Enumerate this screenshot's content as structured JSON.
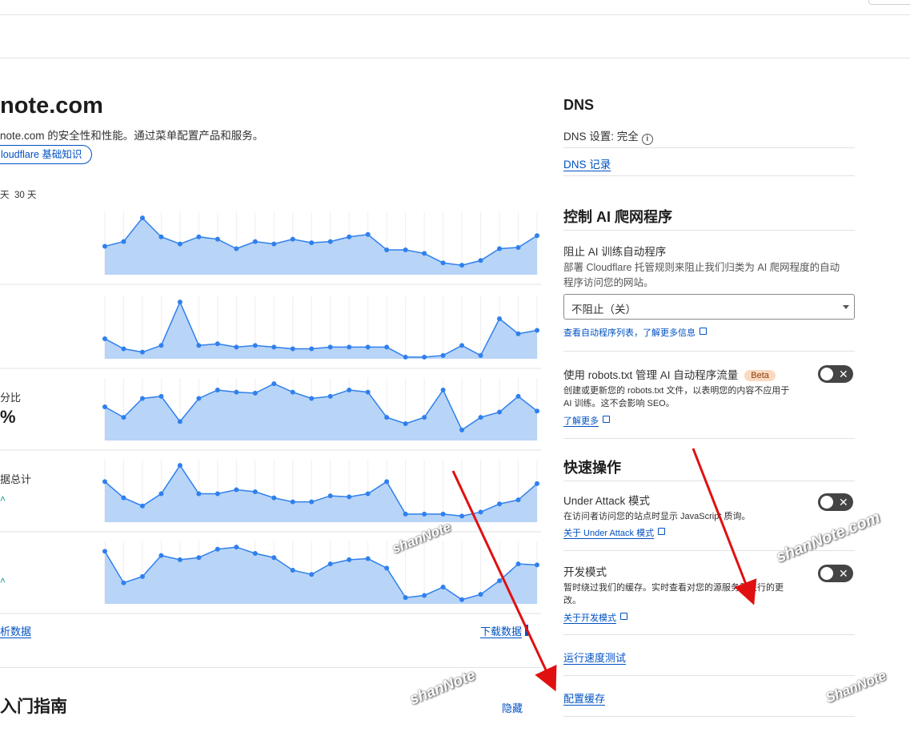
{
  "left": {
    "domain_title": "note.com",
    "domain_desc": "note.com 的安全性和性能。通过菜单配置产品和服务。",
    "basics_pill": "loudflare 基础知识",
    "range_a": "天",
    "range_b": "30 天",
    "metrics": [
      {
        "label": "",
        "value": ""
      },
      {
        "label": "",
        "value": ""
      },
      {
        "label": "分比",
        "value": "%"
      },
      {
        "label": "据总计",
        "value": ""
      },
      {
        "label": "",
        "value": ""
      }
    ],
    "analytics_link": "析数据",
    "download_link": "下载数据",
    "guide_title": "入门指南",
    "hide_link": "隐藏"
  },
  "chart_data": [
    {
      "type": "area",
      "title": "",
      "values": [
        12,
        14,
        24,
        16,
        13,
        16,
        15,
        11,
        14,
        13,
        15,
        13.5,
        14,
        16,
        17,
        10.5,
        10.5,
        9,
        5,
        4,
        6,
        11,
        11.5,
        16.5
      ],
      "color": "#2f80ed"
    },
    {
      "type": "area",
      "title": "",
      "values": [
        6,
        3,
        2,
        4,
        17,
        4,
        4.5,
        3.5,
        4,
        3.5,
        3,
        3,
        3.5,
        3.5,
        3.5,
        3.5,
        0.5,
        0.5,
        1,
        4,
        1,
        12,
        7.5,
        8.5
      ],
      "color": "#2f80ed"
    },
    {
      "type": "area",
      "title": "",
      "values": [
        16,
        11,
        20,
        21,
        9,
        20,
        24,
        23,
        22.5,
        27,
        23,
        20,
        21,
        24,
        23,
        11,
        8,
        11,
        24,
        5,
        11,
        13.5,
        21,
        14
      ],
      "color": "#2f80ed"
    },
    {
      "type": "area",
      "title": "",
      "values": [
        20,
        12,
        8,
        14,
        28,
        14,
        14,
        16,
        15,
        12,
        10,
        10,
        13,
        12.5,
        14,
        20,
        4,
        4,
        4,
        3,
        5,
        9,
        11,
        19
      ],
      "color": "#2f80ed"
    },
    {
      "type": "area",
      "title": "",
      "values": [
        25,
        10,
        13,
        23,
        21,
        22,
        26,
        27,
        24,
        22,
        16,
        14,
        19,
        21,
        21.5,
        17,
        3,
        4,
        8,
        2,
        4.5,
        11,
        19,
        18.5
      ],
      "color": "#2f80ed"
    }
  ],
  "right": {
    "dns_title": "DNS",
    "dns_setting": "DNS 设置: 完全",
    "dns_info_icon": "i",
    "dns_records_link": "DNS 记录",
    "ai_title": "控制 AI 爬网程序",
    "block_title": "阻止 AI 训练自动程序",
    "block_desc_1": "部署 Cloudflare 托管规则来阻止我们归类为 AI 爬网程度的自动",
    "block_desc_2": "程序访问您的网站。",
    "select_value": "不阻止（关）",
    "bots_link": "查看自动程序列表，了解更多信息",
    "robots_title": "使用 robots.txt 管理 AI 自动程序流量",
    "beta": "Beta",
    "robots_desc_1": "创建或更新您的 robots.txt 文件，以表明您的内容不应用于",
    "robots_desc_2": "AI 训练。这不会影响 SEO。",
    "learn_more": "了解更多",
    "quick_title": "快速操作",
    "ua_title": "Under Attack 模式",
    "ua_desc": "在访问者访问您的站点时显示 JavaScript 质询。",
    "ua_link": "关于 Under Attack 模式",
    "dev_title": "开发模式",
    "dev_desc_1": "暂时绕过我们的缓存。实时查看对您的源服务器进行的更",
    "dev_desc_2": "改。",
    "dev_link": "关于开发模式",
    "speed_link": "运行速度测试",
    "cache_link": "配置缓存",
    "toggle_x": "✕"
  },
  "watermarks": [
    "shanNote",
    "shanNote.com",
    "shanNote",
    "ShanNote"
  ],
  "colors": {
    "link": "#0051c3",
    "chart_line": "#2f80ed",
    "chart_fill": "#b8d4f7",
    "arrow": "#e01010"
  }
}
